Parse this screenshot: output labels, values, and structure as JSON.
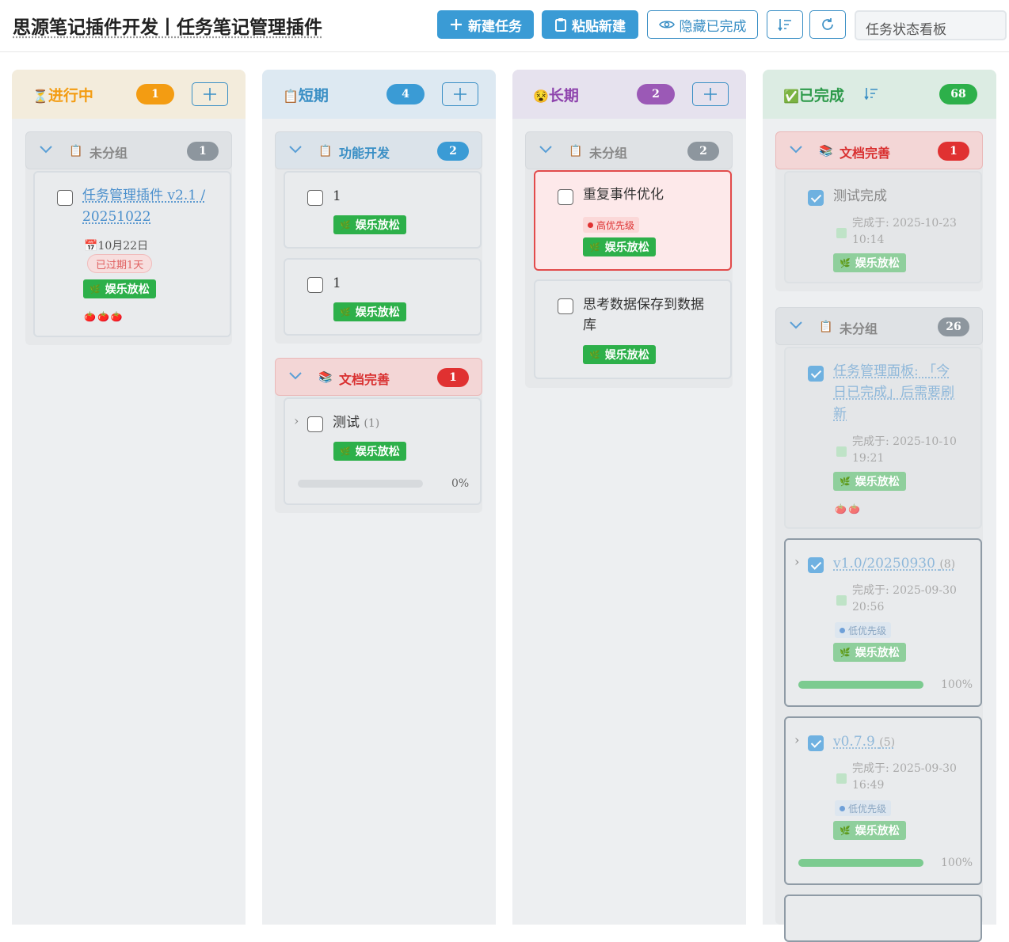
{
  "header": {
    "title": "思源笔记插件开发丨任务笔记管理插件",
    "new_task": "新建任务",
    "paste_new": "粘贴新建",
    "hide_done": "隐藏已完成",
    "search_value": "任务状态看板"
  },
  "columns": {
    "in_progress": {
      "title": "进行中",
      "count": "1",
      "color": "#f39c12"
    },
    "short_term": {
      "title": "短期",
      "count": "4",
      "color": "#3a9bd5"
    },
    "long_term": {
      "title": "长期",
      "count": "2",
      "color": "#9b59b6"
    },
    "done": {
      "title": "已完成",
      "count": "68",
      "color": "#2db04a"
    }
  },
  "col1": {
    "group1": {
      "title": "未分组",
      "count": "1"
    },
    "card1": {
      "title_line1": "任务管理插件 v2.1 /",
      "title_line2": "20251022",
      "date": "10月22日",
      "overdue": "已过期1天",
      "tag": "娱乐放松",
      "tomatoes": "🍅🍅🍅"
    }
  },
  "col2": {
    "group1": {
      "title": "功能开发",
      "count": "2"
    },
    "card1": {
      "title": "1",
      "tag": "娱乐放松"
    },
    "card2": {
      "title": "1",
      "tag": "娱乐放松"
    },
    "group2": {
      "title": "文档完善",
      "count": "1"
    },
    "card3": {
      "title": "测试",
      "subcount": "(1)",
      "tag": "娱乐放松",
      "progress_label": "0%",
      "progress": 0
    }
  },
  "col3": {
    "group1": {
      "title": "未分组",
      "count": "2"
    },
    "card1": {
      "title": "重复事件优化",
      "priority": "高优先级",
      "tag": "娱乐放松"
    },
    "card2": {
      "title_line1": "思考数据保存到数据",
      "title_line2": "库",
      "tag": "娱乐放松"
    }
  },
  "col4": {
    "group1": {
      "title": "文档完善",
      "count": "1"
    },
    "card1": {
      "title": "测试完成",
      "completed_line1": "完成于: 2025-10-23",
      "completed_line2": "10:14",
      "tag": "娱乐放松"
    },
    "group2": {
      "title": "未分组",
      "count": "26"
    },
    "card2": {
      "title_line1": "任务管理面板: 「今",
      "title_line2": "日已完成」后需要刷",
      "title_line3": "新",
      "completed_line1": "完成于: 2025-10-10",
      "completed_line2": "19:21",
      "tag": "娱乐放松",
      "tomatoes": "🍅🍅"
    },
    "card3": {
      "title": "v1.0/20250930",
      "subcount": "(8)",
      "completed_line1": "完成于: 2025-09-30",
      "completed_line2": "20:56",
      "priority": "低优先级",
      "tag": "娱乐放松",
      "progress_label": "100%",
      "progress": 1
    },
    "card4": {
      "title": "v0.7.9",
      "subcount": "(5)",
      "completed_line1": "完成于: 2025-09-30",
      "completed_line2": "16:49",
      "priority": "低优先级",
      "tag": "娱乐放松",
      "progress_label": "100%",
      "progress": 1
    }
  }
}
